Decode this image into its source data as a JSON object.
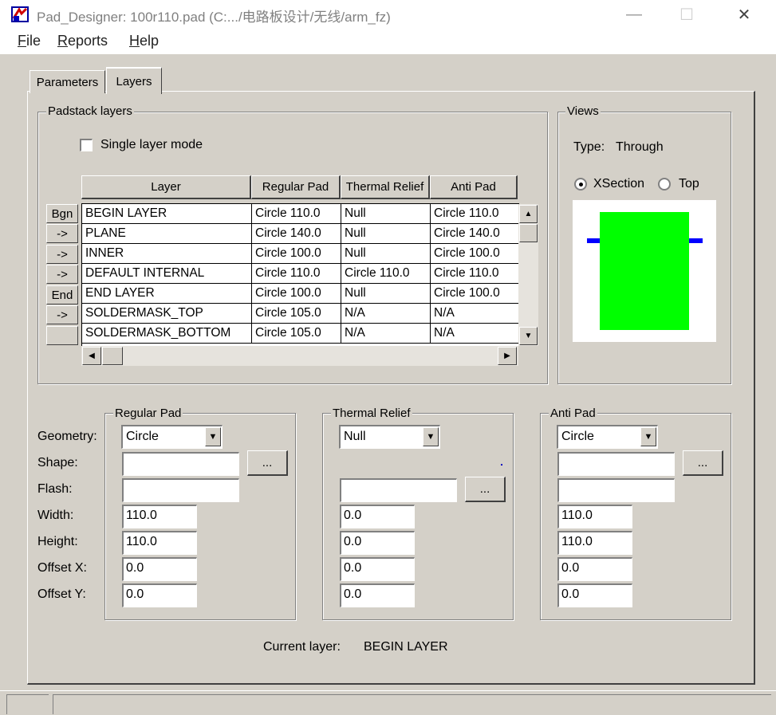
{
  "window": {
    "title": "Pad_Designer: 100r110.pad (C:.../电路板设计/无线/arm_fz)",
    "minimize_glyph": "—",
    "maximize_glyph": "☐",
    "close_glyph": "✕"
  },
  "menu": [
    {
      "label": "File",
      "accel": "F",
      "rest": "ile"
    },
    {
      "label": "Reports",
      "accel": "R",
      "rest": "eports"
    },
    {
      "label": "Help",
      "accel": "H",
      "rest": "elp"
    }
  ],
  "tabs": {
    "parameters": "Parameters",
    "layers": "Layers",
    "active": "Layers"
  },
  "padstack": {
    "group_label": "Padstack layers",
    "single_layer_mode": {
      "label": "Single layer mode",
      "checked": false
    },
    "columns": [
      "Layer",
      "Regular Pad",
      "Thermal Relief",
      "Anti Pad"
    ],
    "rows": [
      {
        "btn": "Bgn",
        "layer": "BEGIN LAYER",
        "regular": "Circle 110.0",
        "thermal": "Null",
        "anti": "Circle 110.0"
      },
      {
        "btn": "->",
        "layer": "PLANE",
        "regular": "Circle 140.0",
        "thermal": "Null",
        "anti": "Circle 140.0"
      },
      {
        "btn": "->",
        "layer": "INNER",
        "regular": "Circle 100.0",
        "thermal": "Null",
        "anti": "Circle 100.0"
      },
      {
        "btn": "->",
        "layer": "DEFAULT INTERNAL",
        "regular": "Circle 110.0",
        "thermal": "Circle 110.0",
        "anti": "Circle 110.0"
      },
      {
        "btn": "End",
        "layer": "END LAYER",
        "regular": "Circle 100.0",
        "thermal": "Null",
        "anti": "Circle 100.0"
      },
      {
        "btn": "->",
        "layer": "SOLDERMASK_TOP",
        "regular": "Circle 105.0",
        "thermal": "N/A",
        "anti": "N/A"
      },
      {
        "btn": "",
        "layer": "SOLDERMASK_BOTTOM",
        "regular": "Circle 105.0",
        "thermal": "N/A",
        "anti": "N/A"
      }
    ]
  },
  "views": {
    "group_label": "Views",
    "type_label": "Type:",
    "type_value": "Through",
    "radio_xsection": "XSection",
    "radio_top": "Top",
    "selected": "XSection",
    "colors": {
      "pad": "#00ff00",
      "plane": "#0000ff",
      "bg": "#ffffff"
    }
  },
  "pad_form": {
    "row_labels": {
      "geometry": "Geometry:",
      "shape": "Shape:",
      "flash": "Flash:",
      "width": "Width:",
      "height": "Height:",
      "offset_x": "Offset X:",
      "offset_y": "Offset Y:"
    },
    "regular": {
      "label": "Regular Pad",
      "geometry": "Circle",
      "shape": "",
      "flash": "",
      "width": "110.0",
      "height": "110.0",
      "offset_x": "0.0",
      "offset_y": "0.0"
    },
    "thermal": {
      "label": "Thermal Relief",
      "geometry": "Null",
      "flash": "",
      "width": "0.0",
      "height": "0.0",
      "offset_x": "0.0",
      "offset_y": "0.0"
    },
    "anti": {
      "label": "Anti Pad",
      "geometry": "Circle",
      "shape": "",
      "flash": "",
      "width": "110.0",
      "height": "110.0",
      "offset_x": "0.0",
      "offset_y": "0.0"
    },
    "browse_label": "..."
  },
  "current_layer": {
    "label": "Current layer:",
    "value": "BEGIN LAYER"
  }
}
